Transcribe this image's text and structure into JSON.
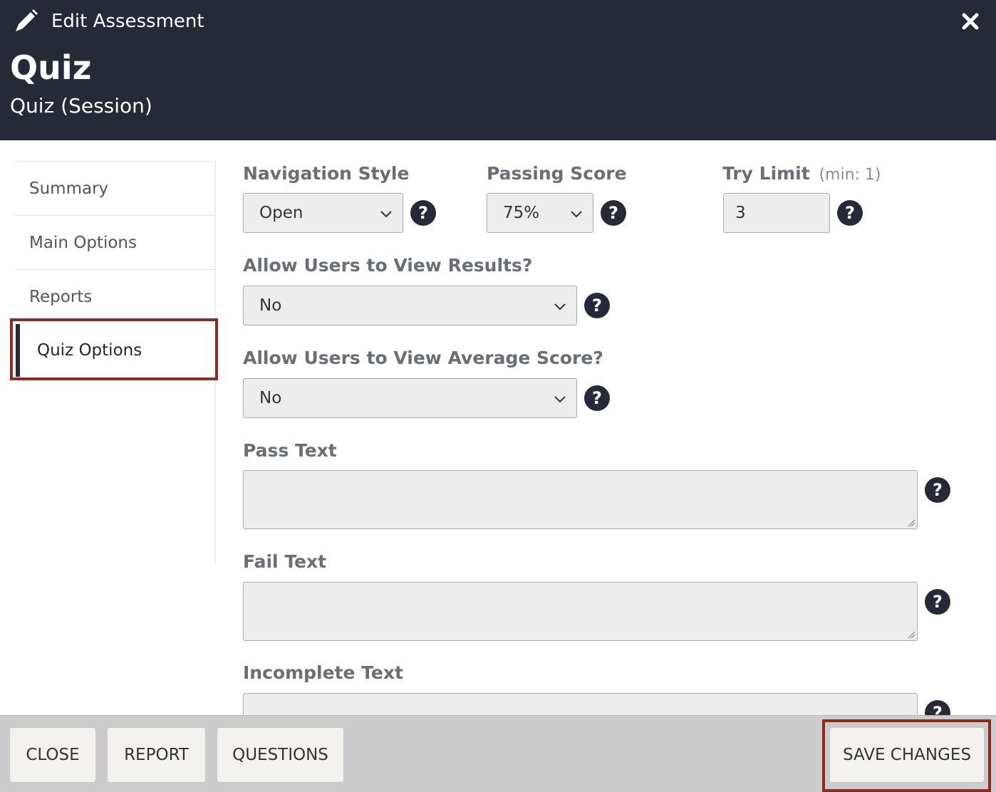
{
  "header": {
    "edit_label": "Edit Assessment",
    "title": "Quiz",
    "subtitle": "Quiz (Session)"
  },
  "sidebar": {
    "items": [
      {
        "label": "Summary"
      },
      {
        "label": "Main Options"
      },
      {
        "label": "Reports"
      },
      {
        "label": "Quiz Options"
      }
    ],
    "active": "Quiz Options"
  },
  "form": {
    "navigation_style": {
      "label": "Navigation Style",
      "value": "Open"
    },
    "passing_score": {
      "label": "Passing Score",
      "value": "75%"
    },
    "try_limit": {
      "label": "Try Limit",
      "hint": "(min: 1)",
      "value": "3"
    },
    "view_results": {
      "label": "Allow Users to View Results?",
      "value": "No"
    },
    "view_average": {
      "label": "Allow Users to View Average Score?",
      "value": "No"
    },
    "pass_text": {
      "label": "Pass Text",
      "value": ""
    },
    "fail_text": {
      "label": "Fail Text",
      "value": ""
    },
    "incomplete_text": {
      "label": "Incomplete Text",
      "value": ""
    },
    "help_glyph": "?"
  },
  "footer": {
    "close_label": "CLOSE",
    "report_label": "REPORT",
    "questions_label": "QUESTIONS",
    "save_label": "SAVE CHANGES"
  },
  "colors": {
    "header_bg": "#262a37",
    "highlight": "#8c2c1f"
  }
}
